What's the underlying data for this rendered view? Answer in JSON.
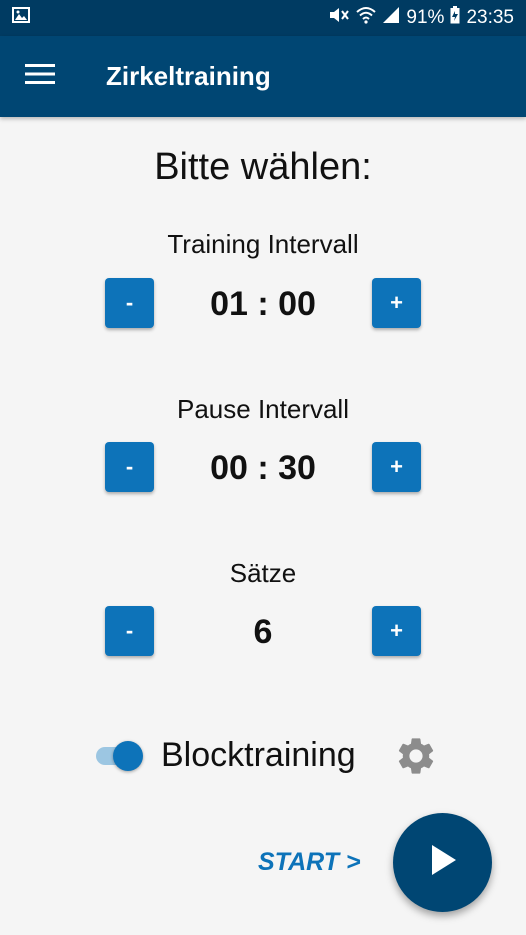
{
  "status_bar": {
    "battery": "91%",
    "time": "23:35",
    "icons": [
      "image-icon",
      "mute-icon",
      "wifi-icon",
      "signal-icon",
      "battery-icon"
    ]
  },
  "app_bar": {
    "title": "Zirkeltraining",
    "menu_icon": "hamburger-icon"
  },
  "heading": "Bitte wählen:",
  "training": {
    "label": "Training Intervall",
    "value": "01 : 00",
    "minus": "-",
    "plus": "+"
  },
  "pause": {
    "label": "Pause Intervall",
    "value": "00 : 30",
    "minus": "-",
    "plus": "+"
  },
  "saetze": {
    "label": "Sätze",
    "value": "6",
    "minus": "-",
    "plus": "+"
  },
  "blocktraining": {
    "label": "Blocktraining",
    "enabled": true,
    "settings_icon": "gear-icon"
  },
  "start": {
    "label": "START >",
    "fab_icon": "play-icon"
  },
  "colors": {
    "primary": "#004673",
    "status_bar": "#003b62",
    "accent": "#0d73b9",
    "background": "#f5f5f5"
  }
}
